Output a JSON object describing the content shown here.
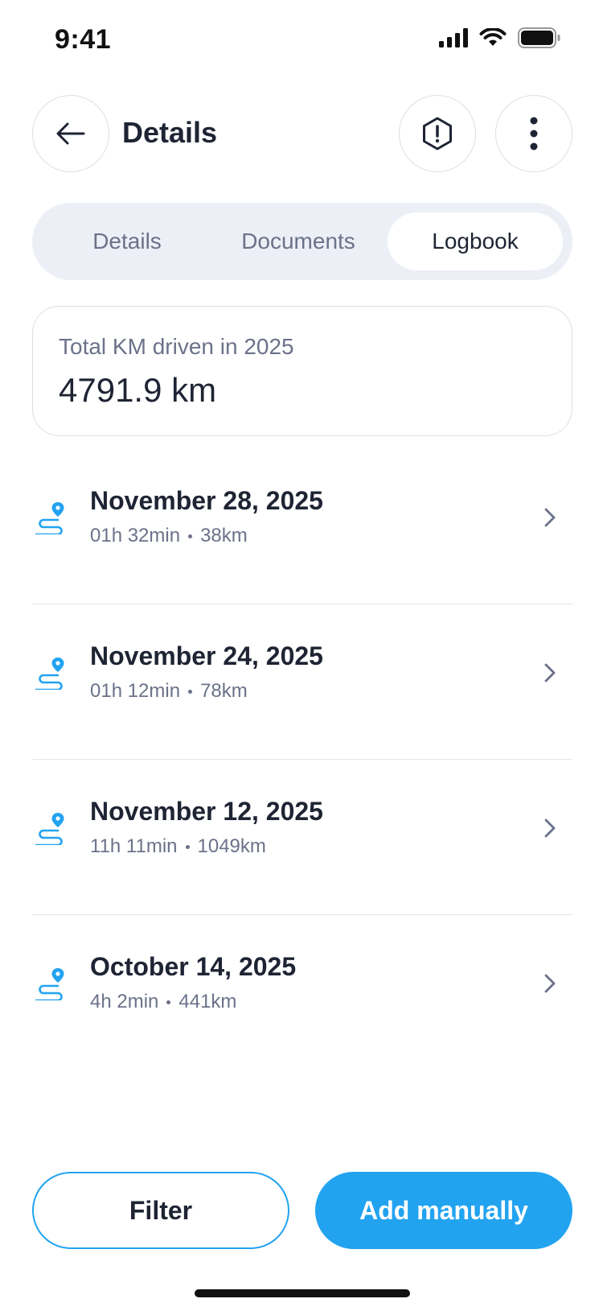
{
  "status_bar": {
    "time": "9:41",
    "icons": [
      "signal-icon",
      "wifi-icon",
      "battery-icon"
    ]
  },
  "header": {
    "title": "Details",
    "back_icon": "arrow-left-icon",
    "alert_icon": "alert-hexagon-icon",
    "more_icon": "more-vertical-icon"
  },
  "tabs": {
    "items": [
      {
        "label": "Details",
        "active": false
      },
      {
        "label": "Documents",
        "active": false
      },
      {
        "label": "Logbook",
        "active": true
      }
    ]
  },
  "summary": {
    "label": "Total KM driven in 2025",
    "value": "4791.9 km"
  },
  "trips": [
    {
      "date": "November 28, 2025",
      "duration": "01h 32min",
      "distance": "38km"
    },
    {
      "date": "November 24, 2025",
      "duration": "01h 12min",
      "distance": "78km"
    },
    {
      "date": "November 12, 2025",
      "duration": "11h 11min",
      "distance": "1049km"
    },
    {
      "date": "October 14, 2025",
      "duration": "4h 2min",
      "distance": "441km"
    }
  ],
  "actions": {
    "filter_label": "Filter",
    "add_label": "Add manually"
  },
  "colors": {
    "accent": "#22a3f0",
    "text_primary": "#1e2433",
    "text_secondary": "#6b7289",
    "tab_background": "#eceff6"
  }
}
